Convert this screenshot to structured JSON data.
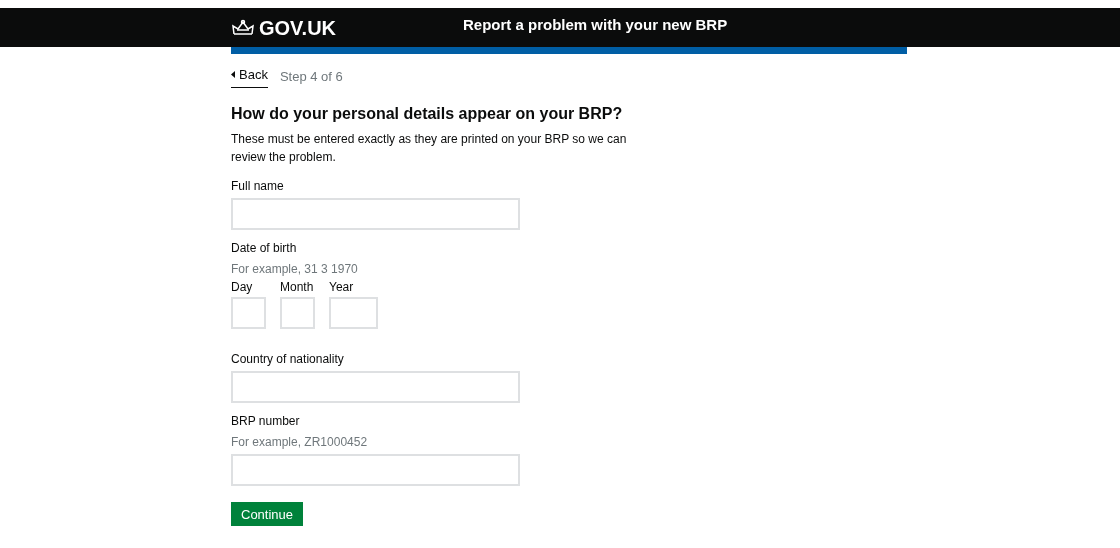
{
  "header": {
    "logo": "GOV.UK",
    "service_name": "Report a problem with your new BRP"
  },
  "back_link": "Back",
  "step": "Step 4 of 6",
  "heading": "How do your personal details appear on your BRP?",
  "intro": "These must be entered exactly as they are printed on your BRP so we can review the problem.",
  "fields": [
    {
      "kind": "text",
      "label": "Full name"
    },
    {
      "kind": "date",
      "label": "Date of birth",
      "hint": "For example, 31 3 1970",
      "parts": [
        "Day",
        "Month",
        "Year"
      ]
    },
    {
      "kind": "text",
      "label": "Country of nationality"
    },
    {
      "kind": "text",
      "label": "BRP number",
      "hint": "For example, ZR1000452"
    }
  ],
  "button": "Continue"
}
